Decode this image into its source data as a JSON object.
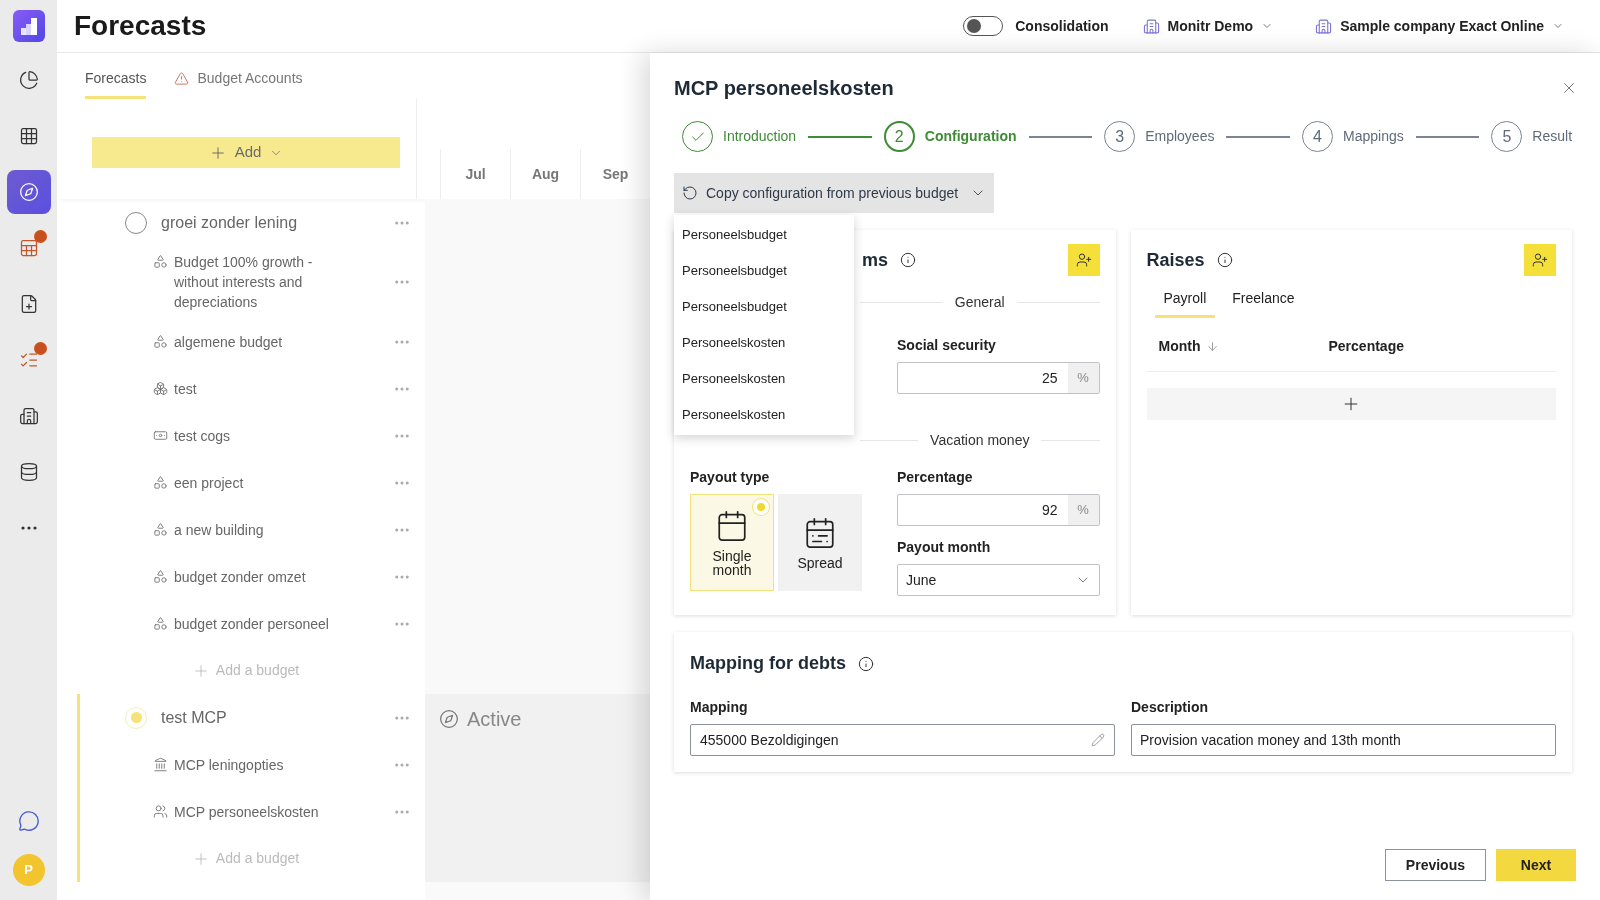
{
  "rail": {
    "items": [
      {
        "kind": "charts",
        "selected": false,
        "alert": false
      },
      {
        "kind": "grid",
        "selected": false,
        "alert": false
      },
      {
        "kind": "forecast",
        "selected": true,
        "alert": false
      },
      {
        "kind": "tableedit",
        "selected": false,
        "alert": true
      },
      {
        "kind": "docadd",
        "selected": false,
        "alert": false
      },
      {
        "kind": "checklist",
        "selected": false,
        "alert": true
      },
      {
        "kind": "building",
        "selected": false,
        "alert": false
      },
      {
        "kind": "database",
        "selected": false,
        "alert": false
      },
      {
        "kind": "more",
        "selected": false,
        "alert": false
      }
    ],
    "avatar": "P"
  },
  "header": {
    "title": "Forecasts",
    "consolidation": {
      "label": "Consolidation",
      "on": false
    },
    "environment": "Monitr Demo",
    "company": "Sample company Exact Online"
  },
  "tabs": [
    {
      "label": "Forecasts",
      "selected": true,
      "warning": false
    },
    {
      "label": "Budget Accounts",
      "selected": false,
      "warning": true
    }
  ],
  "add_button": "Add",
  "months": [
    "Jul",
    "Aug",
    "Sep"
  ],
  "groups": [
    {
      "name": "groei zonder lening",
      "selected": false,
      "items": [
        {
          "name": "Budget 100% growth - without interests and depreciations",
          "kind": "scenario"
        },
        {
          "name": "algemene budget",
          "kind": "scenario"
        },
        {
          "name": "test",
          "kind": "boxes"
        },
        {
          "name": "test cogs",
          "kind": "money"
        },
        {
          "name": "een project",
          "kind": "scenario"
        },
        {
          "name": "a new building",
          "kind": "scenario"
        },
        {
          "name": "budget zonder omzet",
          "kind": "scenario"
        },
        {
          "name": "budget zonder personeel",
          "kind": "scenario"
        }
      ],
      "add_label": "Add a budget"
    },
    {
      "name": "test MCP",
      "selected": true,
      "status": "Active",
      "items": [
        {
          "name": "MCP leningopties",
          "kind": "bank"
        },
        {
          "name": "MCP personeelskosten",
          "kind": "people"
        }
      ],
      "add_label": "Add a budget"
    }
  ],
  "drawer": {
    "title": "MCP personeelskosten",
    "steps": [
      {
        "label": "Introduction",
        "completed": true,
        "selected": false
      },
      {
        "number": "2",
        "label": "Configuration",
        "completed": false,
        "selected": true
      },
      {
        "number": "3",
        "label": "Employees",
        "completed": false,
        "selected": false
      },
      {
        "number": "4",
        "label": "Mappings",
        "completed": false,
        "selected": false
      },
      {
        "number": "5",
        "label": "Result",
        "completed": false,
        "selected": false
      }
    ],
    "copy_button": "Copy configuration from previous budget",
    "copy_menu": {
      "expanded": true,
      "options": [
        "Personeelsbudget",
        "Personeelsbudget",
        "Personeelsbudget",
        "Personeelskosten",
        "Personeelskosten",
        "Personeelskosten"
      ]
    },
    "systems_card": {
      "title": "ms",
      "general_label": "General",
      "social_security": {
        "label": "Social security",
        "value": "25",
        "unit": "%"
      },
      "vacation_label": "Vacation money",
      "payout_type": {
        "label": "Payout type",
        "options": [
          {
            "label": "Single month",
            "kind": "single",
            "selected": true
          },
          {
            "label": "Spread",
            "kind": "spread",
            "selected": false
          }
        ]
      },
      "percentage": {
        "label": "Percentage",
        "value": "92",
        "unit": "%"
      },
      "payout_month": {
        "label": "Payout month",
        "value": "June"
      }
    },
    "raises_card": {
      "title": "Raises",
      "tabs": [
        {
          "label": "Payroll",
          "selected": true
        },
        {
          "label": "Freelance",
          "selected": false
        }
      ],
      "columns": [
        "Month",
        "Percentage"
      ]
    },
    "mapping_card": {
      "title": "Mapping for debts",
      "mapping": {
        "label": "Mapping",
        "value": "455000 Bezoldigingen"
      },
      "description": {
        "label": "Description",
        "value": "Provision vacation money and 13th month"
      }
    },
    "footer": {
      "previous": "Previous",
      "next": "Next"
    }
  }
}
